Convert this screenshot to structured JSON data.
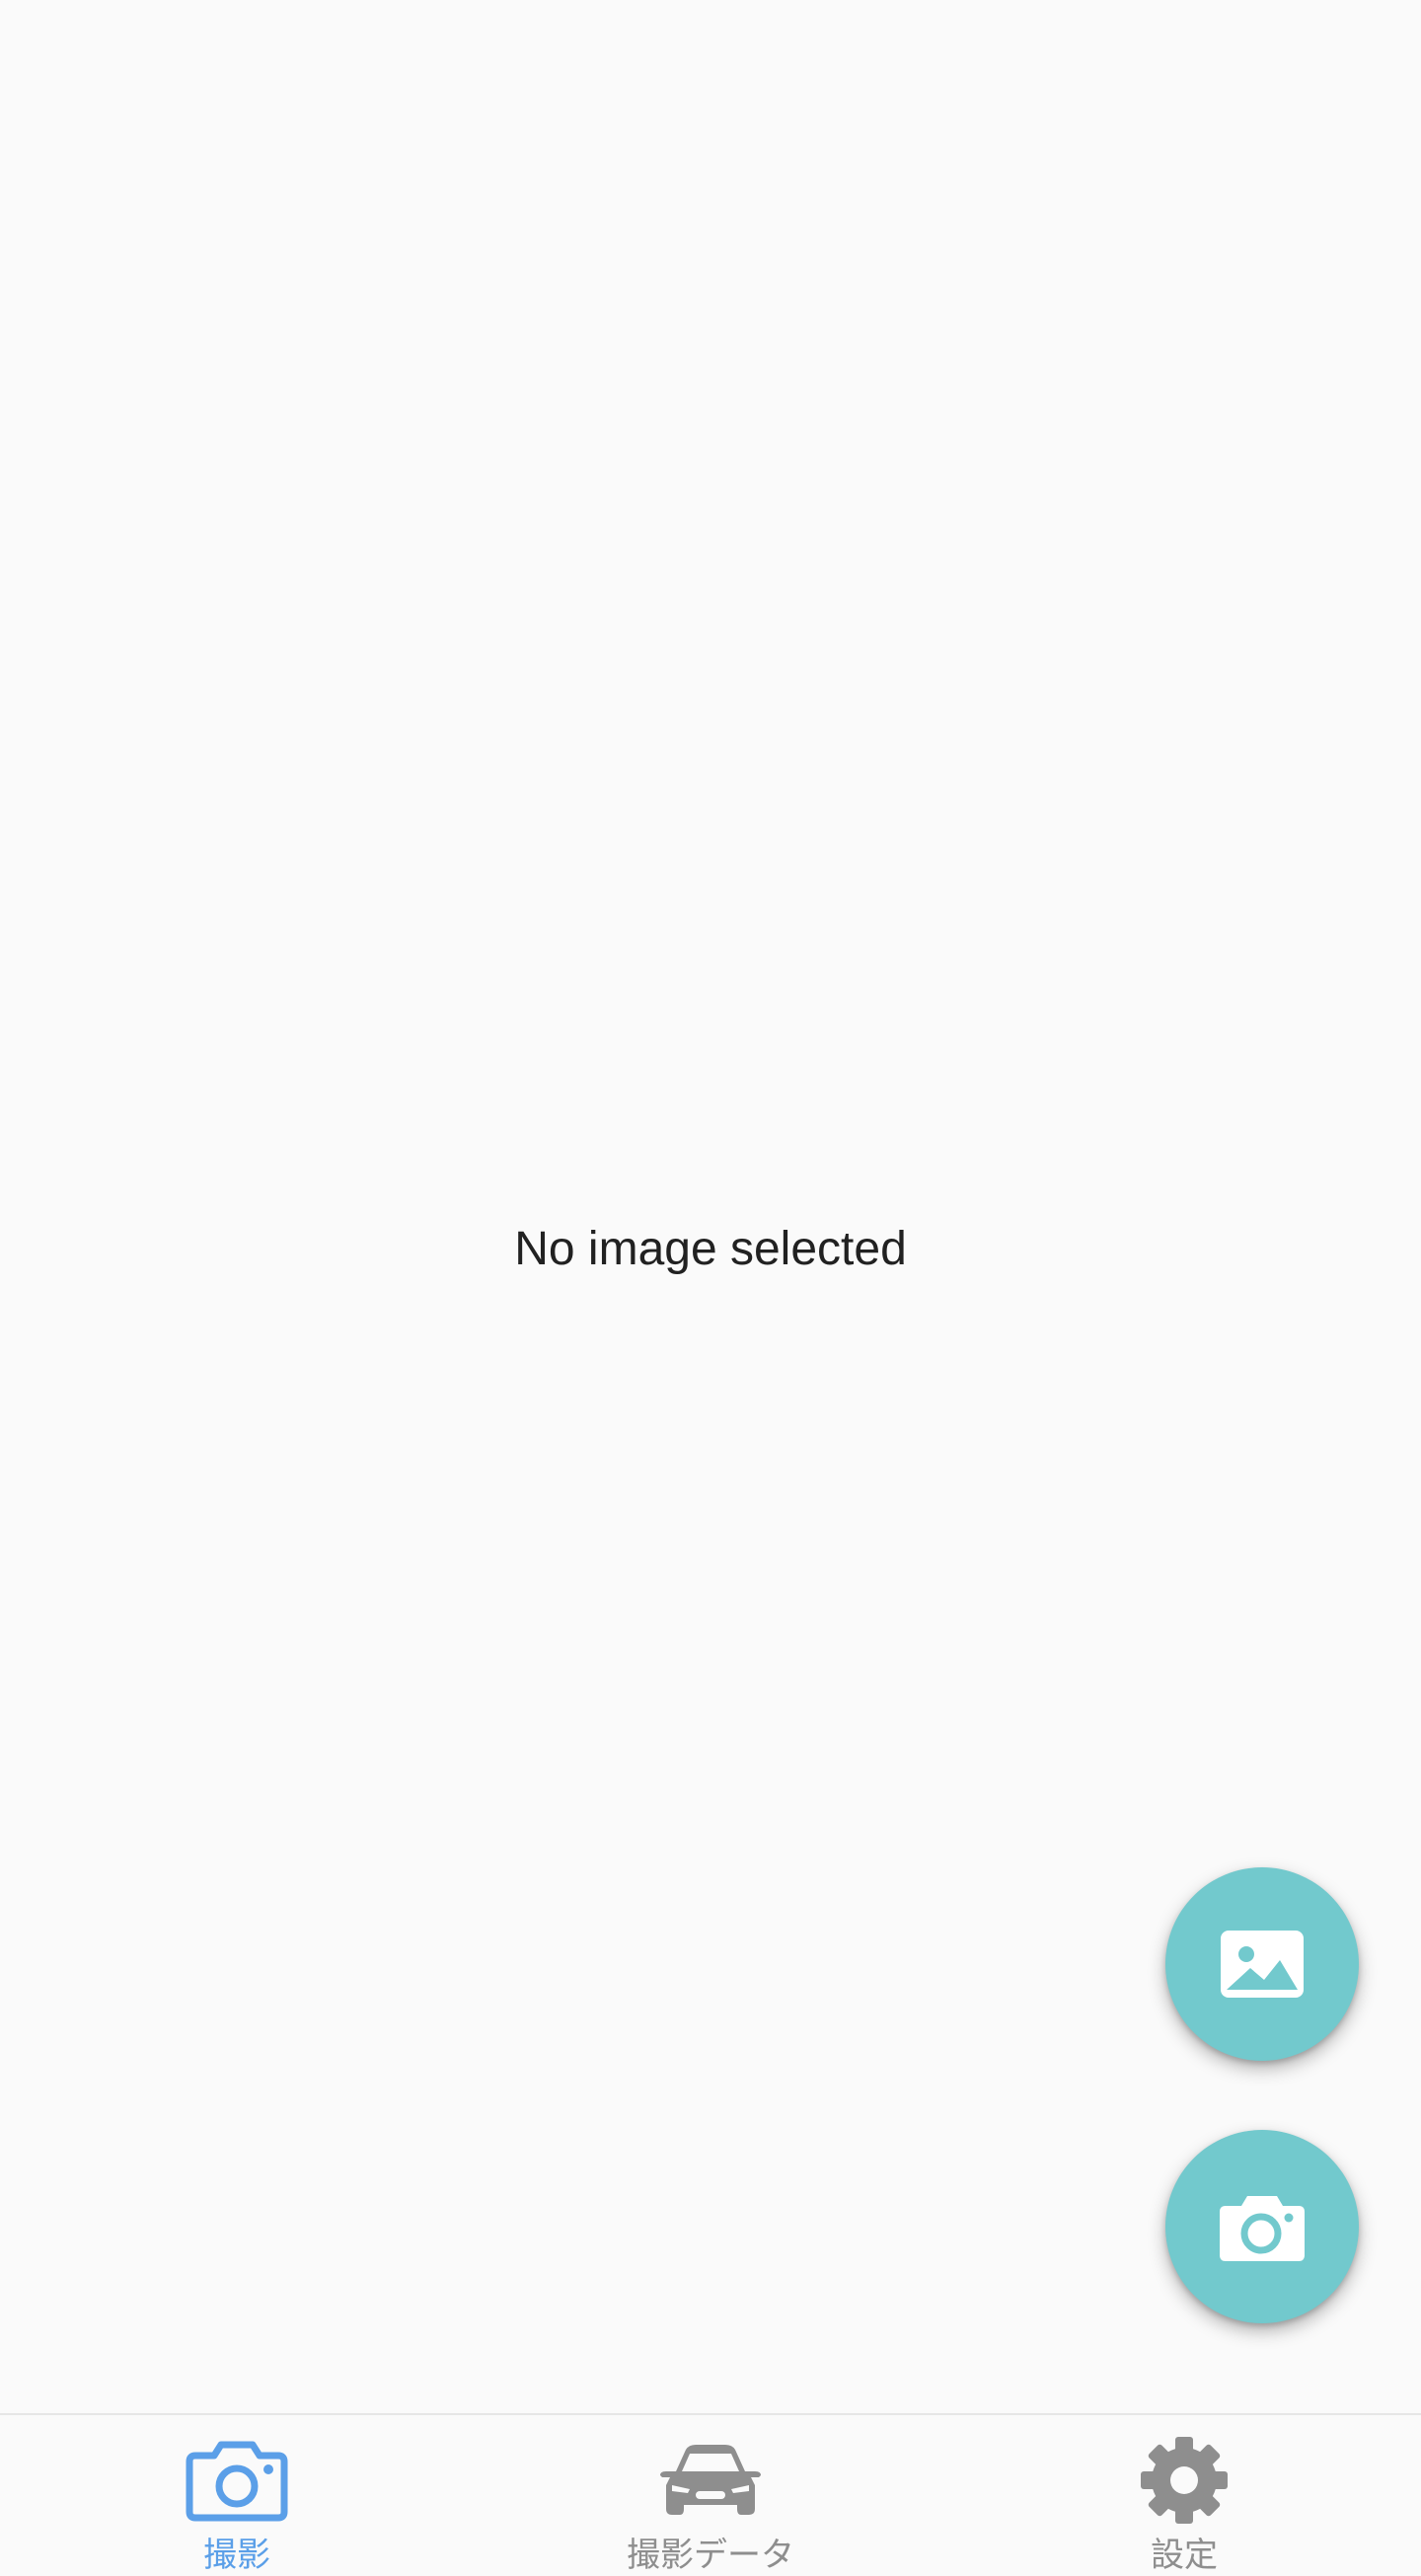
{
  "main": {
    "empty_message": "No image selected"
  },
  "fabs": {
    "gallery": {
      "icon": "image-icon"
    },
    "camera": {
      "icon": "camera-icon"
    }
  },
  "bottom_nav": {
    "items": [
      {
        "label": "撮影",
        "icon": "camera-outline-icon",
        "active": true
      },
      {
        "label": "撮影データ",
        "icon": "car-icon",
        "active": false
      },
      {
        "label": "設定",
        "icon": "gear-icon",
        "active": false
      }
    ]
  },
  "colors": {
    "background": "#fafafa",
    "fab": "#72c9cd",
    "nav_active": "#5b9fe8",
    "nav_inactive": "#8e8e8e",
    "text": "#212121"
  }
}
